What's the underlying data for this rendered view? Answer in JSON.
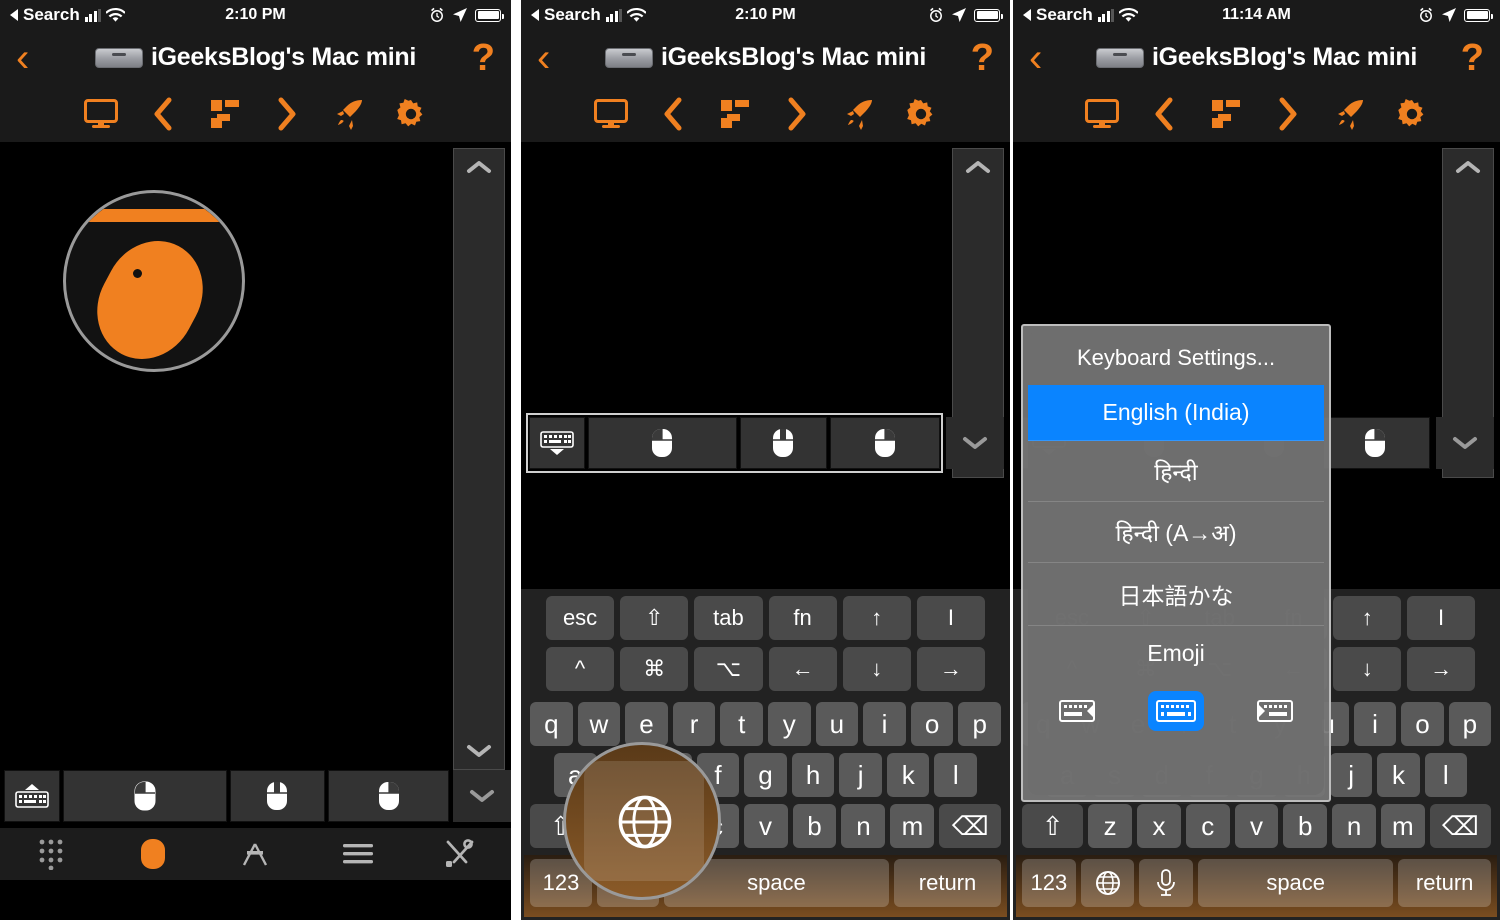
{
  "app": {
    "title": "iGeeksBlog's Mac mini",
    "device_icon": "mac-mini-icon",
    "back_label": "‹",
    "help_label": "?"
  },
  "theme": {
    "accent": "#F08020",
    "selection_blue": "#0a84ff",
    "panel_bg": "#000000",
    "bar_bg": "#1a1a1a",
    "key_bg": "#5a5a5a"
  },
  "panels": [
    {
      "id": "panel-1",
      "status": {
        "carrier": "Search",
        "back_arrow": "◀",
        "time": "2:10 PM"
      },
      "caption": "trackpad view with mouse button row and dock"
    },
    {
      "id": "panel-2",
      "status": {
        "carrier": "Search",
        "back_arrow": "◀",
        "time": "2:10 PM"
      },
      "caption": "keyboard shown, globe key magnified"
    },
    {
      "id": "panel-3",
      "status": {
        "carrier": "Search",
        "back_arrow": "◀",
        "time": "11:14 AM"
      },
      "caption": "keyboard language popup open"
    }
  ],
  "status_icons": {
    "signal": "cellular-signal-icon",
    "wifi": "wifi-icon",
    "alarm": "alarm-clock-icon",
    "location": "location-arrow-icon",
    "battery": "battery-icon"
  },
  "toolbar": {
    "items": [
      {
        "name": "display-button",
        "icon": "monitor-icon"
      },
      {
        "name": "prev-button",
        "icon": "chevron-left-icon"
      },
      {
        "name": "mission-control-button",
        "icon": "windows-tile-icon"
      },
      {
        "name": "next-button",
        "icon": "chevron-right-icon"
      },
      {
        "name": "launchpad-button",
        "icon": "rocket-icon"
      },
      {
        "name": "settings-button",
        "icon": "gear-icon"
      }
    ]
  },
  "panstrip": {
    "up": "chevron-up-icon",
    "down": "chevron-down-icon"
  },
  "mouse_row": {
    "buttons": [
      {
        "name": "show-keyboard-button",
        "icon": "keyboard-down-icon"
      },
      {
        "name": "left-click-button",
        "icon": "mouse-left-icon"
      },
      {
        "name": "middle-click-button",
        "icon": "mouse-middle-icon"
      },
      {
        "name": "right-click-button",
        "icon": "mouse-right-icon"
      }
    ],
    "collapse": {
      "name": "collapse-button",
      "icon": "chevron-down-icon"
    }
  },
  "dock": {
    "items": [
      {
        "name": "numpad-button",
        "icon": "numeric-keypad-icon",
        "label": ""
      },
      {
        "name": "trackpad-button",
        "icon": "mouse-pointer-icon",
        "label": ""
      },
      {
        "name": "app-store-button",
        "icon": "app-store-icon",
        "label": ""
      },
      {
        "name": "menu-button",
        "icon": "hamburger-icon",
        "label": ""
      },
      {
        "name": "tools-button",
        "icon": "wrench-screwdriver-icon",
        "label": ""
      }
    ]
  },
  "keyboard": {
    "mod_row_1": [
      "esc",
      "⇧",
      "tab",
      "fn",
      "↑",
      "I"
    ],
    "mod_row_2": [
      "^",
      "⌘",
      "⌥",
      "←",
      "↓",
      "→"
    ],
    "row_q": [
      "q",
      "w",
      "e",
      "r",
      "t",
      "y",
      "u",
      "i",
      "o",
      "p"
    ],
    "row_a": [
      "a",
      "s",
      "d",
      "f",
      "g",
      "h",
      "j",
      "k",
      "l"
    ],
    "row_z": [
      "⇧",
      "z",
      "x",
      "c",
      "v",
      "b",
      "n",
      "m",
      "⌫"
    ],
    "bottom_p2": [
      "123",
      "globe-icon",
      "space",
      "return"
    ],
    "bottom_p3": [
      "123",
      "globe-icon",
      "mic-icon",
      "space",
      "return"
    ],
    "space_label": "space",
    "return_label": "return",
    "numeric_label": "123",
    "globe_icon": "globe-icon",
    "mic_icon": "microphone-icon",
    "shift_icon": "shift-arrow-icon",
    "delete_icon": "backspace-icon"
  },
  "magnifier": {
    "panel1": {
      "target": "trackpad-button",
      "icon": "orange-mouse-pointer-icon"
    },
    "panel2": {
      "target": "globe-key",
      "icon": "globe-icon"
    }
  },
  "language_popup": {
    "header": "Keyboard Settings...",
    "items": [
      {
        "label": "English (India)",
        "selected": true
      },
      {
        "label": "हिन्दी",
        "selected": false
      },
      {
        "label": "हिन्दी (A→अ)",
        "selected": false
      },
      {
        "label": "日本語かな",
        "selected": false
      },
      {
        "label": "Emoji",
        "selected": false
      }
    ],
    "layout_options": [
      {
        "name": "keyboard-split-left-icon",
        "selected": false
      },
      {
        "name": "keyboard-full-icon",
        "selected": true
      },
      {
        "name": "keyboard-split-right-icon",
        "selected": false
      }
    ]
  }
}
